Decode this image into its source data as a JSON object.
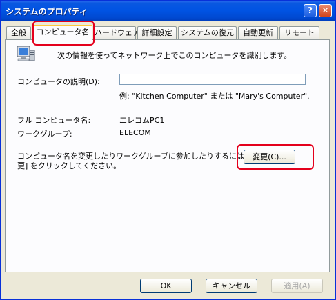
{
  "window": {
    "title": "システムのプロパティ",
    "help_label": "?",
    "close_label": "✕"
  },
  "tabs": [
    {
      "label": "全般"
    },
    {
      "label": "コンピュータ名"
    },
    {
      "label": "ハードウェア"
    },
    {
      "label": "詳細設定"
    },
    {
      "label": "システムの復元"
    },
    {
      "label": "自動更新"
    },
    {
      "label": "リモート"
    }
  ],
  "panel": {
    "intro": "次の情報を使ってネットワーク上でこのコンピュータを識別します。",
    "description_label": "コンピュータの説明(D):",
    "description_value": "",
    "example": "例: \"Kitchen Computer\" または \"Mary's Computer\".",
    "fullname_label": "フル コンピュータ名:",
    "fullname_value": "エレコムPC1",
    "workgroup_label": "ワークグループ:",
    "workgroup_value": "ELECOM",
    "change_text_line1": "コンピュータ名を変更したりワークグループに参加したりするには [変",
    "change_text_line2": "更] をクリックしてください。",
    "change_button": "変更(C)..."
  },
  "footer": {
    "ok_label": "OK",
    "cancel_label": "キャンセル",
    "apply_label": "適用(A)"
  },
  "colors": {
    "title_bar": "#0053e3",
    "dialog_bg": "#ece9d8",
    "highlight": "#e4001c"
  }
}
